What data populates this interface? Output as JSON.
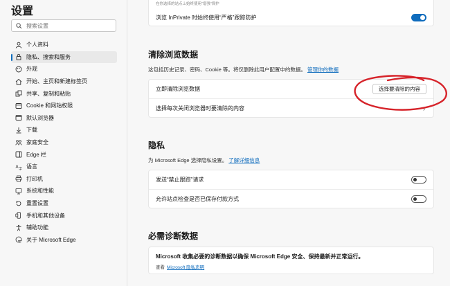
{
  "sidebar": {
    "title": "设置",
    "search_placeholder": "搜索设置",
    "items": [
      {
        "label": "个人资料",
        "icon": "profile-icon"
      },
      {
        "label": "隐私、搜索和服务",
        "icon": "lock-icon",
        "active": true
      },
      {
        "label": "外观",
        "icon": "appearance-icon"
      },
      {
        "label": "开始、主页和新建标签页",
        "icon": "home-icon"
      },
      {
        "label": "共享、复制和粘贴",
        "icon": "share-icon"
      },
      {
        "label": "Cookie 和网站权限",
        "icon": "cookie-icon"
      },
      {
        "label": "默认浏览器",
        "icon": "browser-icon"
      },
      {
        "label": "下载",
        "icon": "download-icon"
      },
      {
        "label": "家庭安全",
        "icon": "family-icon"
      },
      {
        "label": "Edge 栏",
        "icon": "edge-bar-icon"
      },
      {
        "label": "语言",
        "icon": "language-icon"
      },
      {
        "label": "打印机",
        "icon": "printer-icon"
      },
      {
        "label": "系统和性能",
        "icon": "system-icon"
      },
      {
        "label": "重置设置",
        "icon": "reset-icon"
      },
      {
        "label": "手机和其他设备",
        "icon": "phone-icon"
      },
      {
        "label": "辅助功能",
        "icon": "accessibility-icon"
      },
      {
        "label": "关于 Microsoft Edge",
        "icon": "edge-icon"
      }
    ]
  },
  "top_card": {
    "partial_text": "在你选择的站点上始终使用“增强”保护",
    "inprivate_label": "浏览 InPrivate 时始终使用“严格”跟踪防护",
    "inprivate_on": true
  },
  "clear_data": {
    "title": "清除浏览数据",
    "desc": "这包括历史记录、密码、Cookie 等。将仅删除此用户配置中的数据。",
    "desc_link": "管理你的数据",
    "clear_now_label": "立即清除浏览数据",
    "choose_button": "选择要清除的内容",
    "on_close_label": "选择每次关闭浏览器时要清除的内容"
  },
  "privacy": {
    "title": "隐私",
    "desc": "为 Microsoft Edge 选择隐私设置。",
    "desc_link": "了解详细信息",
    "dnt_label": "发送“禁止跟踪”请求",
    "dnt_on": false,
    "payment_label": "允许站点检查是否已保存付款方式",
    "payment_on": false
  },
  "diagnostics": {
    "title": "必需诊断数据",
    "desc": "Microsoft 收集必要的诊断数据以确保 Microsoft Edge 安全、保持最新并正常运行。",
    "view_prefix": "查看",
    "privacy_link": "Microsoft 隐私声明"
  },
  "colors": {
    "accent": "#0f6cbd",
    "annotation": "#d6232a"
  }
}
